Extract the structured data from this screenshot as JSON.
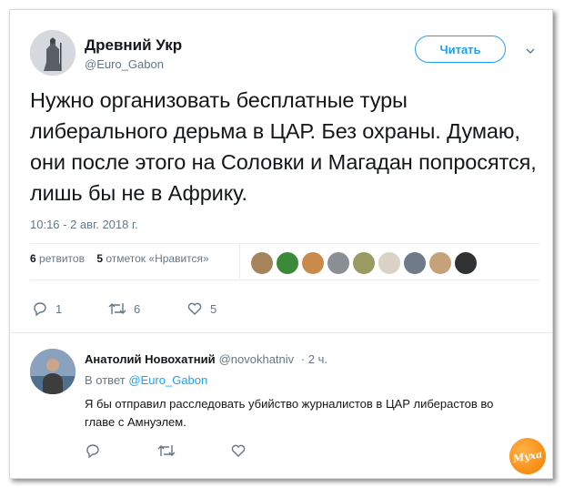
{
  "tweet": {
    "author_name": "Древний Укр",
    "author_handle": "@Euro_Gabon",
    "follow_label": "Читать",
    "text": "Нужно организовать бесплатные туры либерального дерьма в ЦАР. Без охраны. Думаю, они после этого на Соловки и Магадан попросятся, лишь бы не в Африку.",
    "time": "10:16 - 2 авг. 2018 г.",
    "retweets_count": "6",
    "retweets_label": "ретвитов",
    "likes_count": "5",
    "likes_label": "отметок «Нравится»",
    "actions": {
      "replies": "1",
      "retweets": "6",
      "likes": "5"
    }
  },
  "reply": {
    "author_name": "Анатолий Новохатний",
    "author_handle": "@novokhatniv",
    "time": "· 2 ч.",
    "reply_prefix": "В ответ",
    "reply_to": "@Euro_Gabon",
    "text": "Я бы отправил расследовать убийство журналистов в ЦАР либерастов во главе с Амнуэлем."
  },
  "watermark": {
    "text": "Муха"
  },
  "colors": {
    "accent": "#1da1f2",
    "muted": "#657786",
    "text": "#14171a"
  },
  "icons": [
    "reply-icon",
    "retweet-icon",
    "like-icon",
    "chevron-down-icon"
  ]
}
